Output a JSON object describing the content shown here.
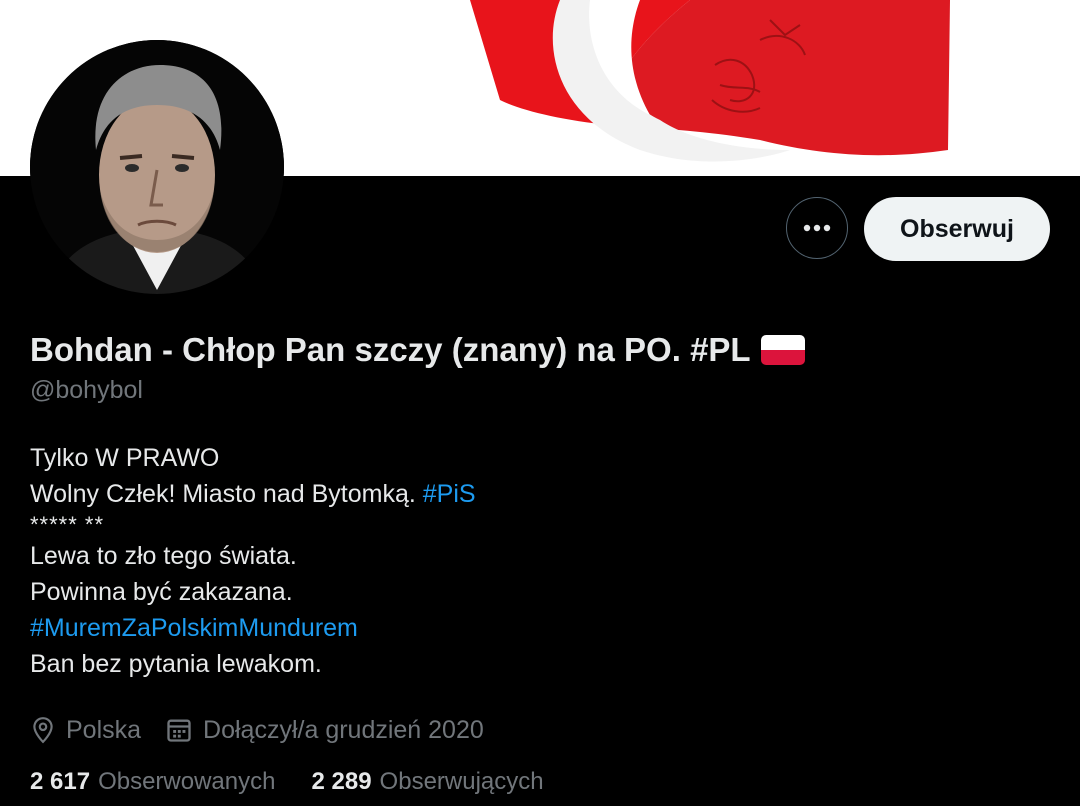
{
  "profile": {
    "display_name": "Bohdan - Chłop Pan szczy (znany) na PO. #PL",
    "flag_emoji": "poland-flag",
    "handle": "@bohybol"
  },
  "actions": {
    "more_icon": "more-horizontal-icon",
    "follow_label": "Obserwuj"
  },
  "bio": {
    "line1": "Tylko W PRAWO",
    "line2_text": "Wolny Człek! Miasto nad Bytomką. ",
    "line2_hashtag": "#PiS",
    "line3": "***** **",
    "line4": "Lewa to zło tego świata.",
    "line5": "Powinna być zakazana.",
    "line6_hashtag": "#MuremZaPolskimMundurem",
    "line7": "Ban bez pytania lewakom."
  },
  "meta": {
    "location_icon": "location-pin-icon",
    "location": "Polska",
    "joined_icon": "calendar-icon",
    "joined": "Dołączył/a grudzień 2020"
  },
  "stats": {
    "following_count": "2 617",
    "following_label": "Obserwowanych",
    "followers_count": "2 289",
    "followers_label": "Obserwujących"
  },
  "colors": {
    "background": "#000000",
    "text": "#e7e9ea",
    "muted": "#71767b",
    "link": "#1d9bf0",
    "follow_button_bg": "#eff3f4",
    "flag_red": "#dc143c"
  }
}
